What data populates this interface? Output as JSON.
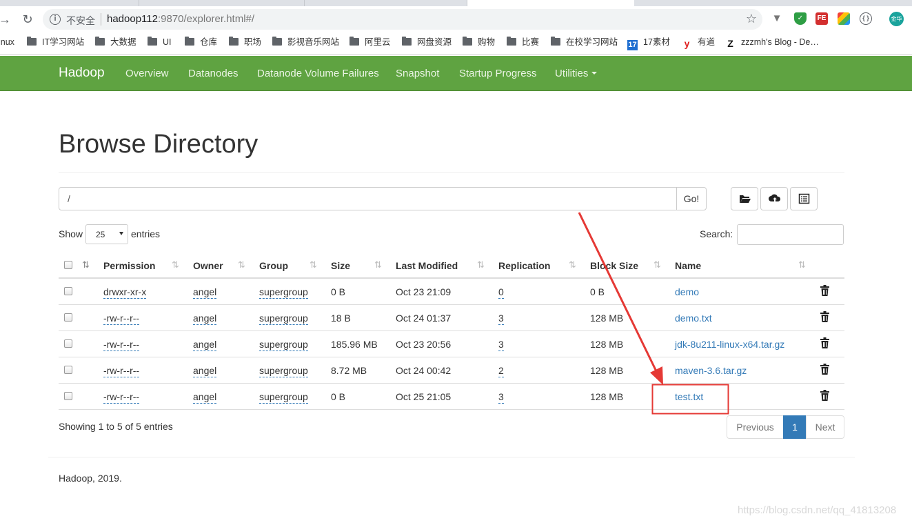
{
  "browser": {
    "insecure_label": "不安全",
    "url_host": "hadoop112",
    "url_path": ":9870/explorer.html#/",
    "bookmarks": [
      "inux",
      "IT学习网站",
      "大数据",
      "UI",
      "仓库",
      "职场",
      "影视音乐网站",
      "阿里云",
      "网盘资源",
      "购物",
      "比赛",
      "在校学习网站",
      "17素材",
      "有道",
      "zzzmh's Blog - De…"
    ],
    "avatar_text": "金华"
  },
  "navbar": {
    "brand": "Hadoop",
    "links": [
      "Overview",
      "Datanodes",
      "Datanode Volume Failures",
      "Snapshot",
      "Startup Progress",
      "Utilities"
    ],
    "color": "#5fa341"
  },
  "page": {
    "title": "Browse Directory",
    "path_value": "/",
    "go_label": "Go!",
    "show_label": "Show",
    "entries_value": "25",
    "entries_label": "entries",
    "search_label": "Search:"
  },
  "table": {
    "headers": [
      "Permission",
      "Owner",
      "Group",
      "Size",
      "Last Modified",
      "Replication",
      "Block Size",
      "Name"
    ],
    "rows": [
      {
        "permission": "drwxr-xr-x",
        "owner": "angel",
        "group": "supergroup",
        "size": "0 B",
        "modified": "Oct 23 21:09",
        "replication": "0",
        "block_size": "0 B",
        "name": "demo"
      },
      {
        "permission": "-rw-r--r--",
        "owner": "angel",
        "group": "supergroup",
        "size": "18 B",
        "modified": "Oct 24 01:37",
        "replication": "3",
        "block_size": "128 MB",
        "name": "demo.txt"
      },
      {
        "permission": "-rw-r--r--",
        "owner": "angel",
        "group": "supergroup",
        "size": "185.96 MB",
        "modified": "Oct 23 20:56",
        "replication": "3",
        "block_size": "128 MB",
        "name": "jdk-8u211-linux-x64.tar.gz"
      },
      {
        "permission": "-rw-r--r--",
        "owner": "angel",
        "group": "supergroup",
        "size": "8.72 MB",
        "modified": "Oct 24 00:42",
        "replication": "2",
        "block_size": "128 MB",
        "name": "maven-3.6.tar.gz"
      },
      {
        "permission": "-rw-r--r--",
        "owner": "angel",
        "group": "supergroup",
        "size": "0 B",
        "modified": "Oct 25 21:05",
        "replication": "3",
        "block_size": "128 MB",
        "name": "test.txt"
      }
    ]
  },
  "info": {
    "showing": "Showing 1 to 5 of 5 entries",
    "previous": "Previous",
    "current_page": "1",
    "next": "Next"
  },
  "footer": {
    "text": "Hadoop, 2019."
  },
  "watermark": "https://blog.csdn.net/qq_41813208",
  "annotation_color": "#e53935"
}
